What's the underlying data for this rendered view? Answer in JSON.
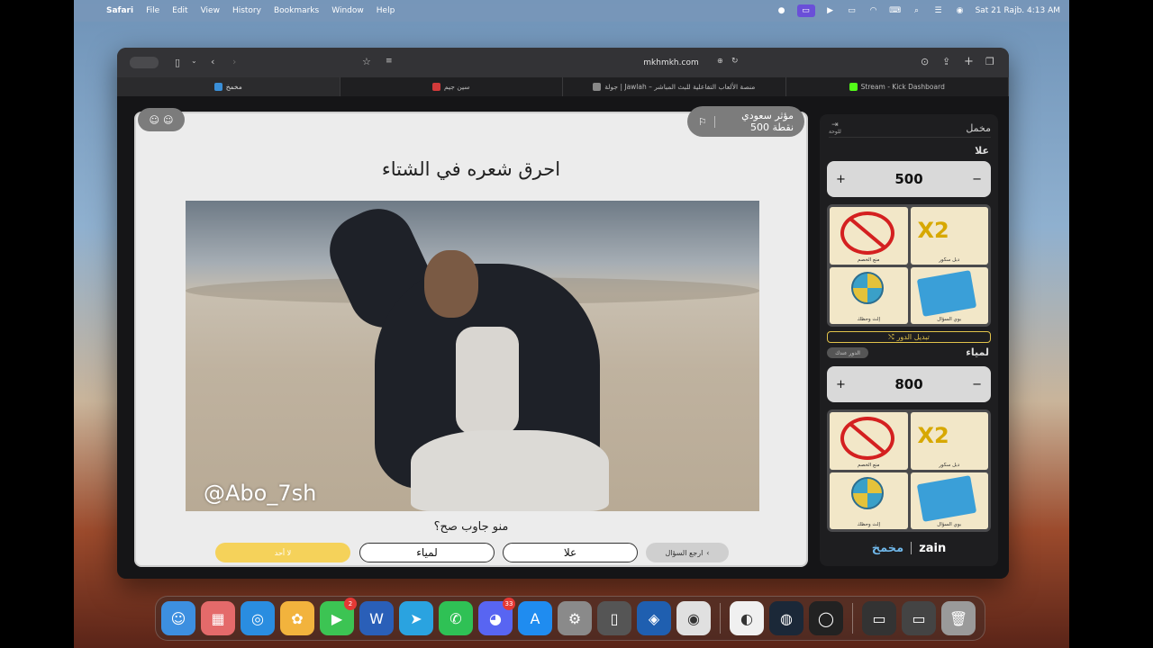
{
  "menubar": {
    "app": "Safari",
    "items": [
      "File",
      "Edit",
      "View",
      "History",
      "Bookmarks",
      "Window",
      "Help"
    ],
    "clock": "Sat 21 Rajb.  4:13 AM"
  },
  "browser": {
    "url": "mkhmkh.com",
    "tabs": [
      {
        "label": "مخمخ",
        "active": true,
        "color": "#3a8fd8"
      },
      {
        "label": "سين جيم",
        "active": false,
        "color": "#d23a3a"
      },
      {
        "label": "جولة | Jawlah – منصة الألعاب التفاعلية للبث المباشر",
        "active": false,
        "color": "#888888"
      },
      {
        "label": "Stream - Kick Dashboard",
        "active": false,
        "color": "#53fc18"
      }
    ]
  },
  "game": {
    "indicator_name": "مؤثر سعودي",
    "indicator_points": "500 نقطة",
    "question": "احرق شعره في الشتاء",
    "watermark": "@Abo_7sh",
    "who_answered": "منو جاوب صح؟",
    "answers": {
      "none": "لا أحد",
      "team2": "لمياء",
      "team1": "علا",
      "back": "ارجع السؤال"
    }
  },
  "panel": {
    "title": "مخمل",
    "exit_label": "للوحة",
    "team1": {
      "name": "علا",
      "score": "500"
    },
    "team2": {
      "name": "لمياء",
      "score": "800"
    },
    "switch_turn": "تبديل الدور",
    "turn_badge": "الدور عندك",
    "powerups": [
      "منع الخصم",
      "دبل سكور",
      "إلث وحظك",
      "بوي السؤال"
    ],
    "brand": "zain",
    "brand_logo": "مخمخ"
  },
  "dock": {
    "apps": [
      {
        "name": "finder-icon",
        "color": "#3d8fe0"
      },
      {
        "name": "launchpad-icon",
        "color": "#e46a6a"
      },
      {
        "name": "safari-icon",
        "color": "#2a8de0"
      },
      {
        "name": "photos-icon",
        "color": "#f2b33d"
      },
      {
        "name": "facetime-icon",
        "color": "#3cc453",
        "badge": "2"
      },
      {
        "name": "word-icon",
        "color": "#2a5fb8"
      },
      {
        "name": "telegram-icon",
        "color": "#2aa3e0"
      },
      {
        "name": "whatsapp-icon",
        "color": "#2fc155"
      },
      {
        "name": "discord-icon",
        "color": "#5865f2",
        "badge": "33"
      },
      {
        "name": "appstore-icon",
        "color": "#1f8cf0"
      },
      {
        "name": "settings-icon",
        "color": "#8a8a8a"
      },
      {
        "name": "iphone-mirroring-icon",
        "color": "#555555"
      },
      {
        "name": "vmware-icon",
        "color": "#1f5fb0"
      },
      {
        "name": "chrome-icon",
        "color": "#e0e0e0"
      },
      {
        "name": "obs-monitor-icon",
        "color": "#f0f0f0"
      },
      {
        "name": "steam-icon",
        "color": "#1b2838"
      },
      {
        "name": "obs-icon",
        "color": "#222222"
      },
      {
        "name": "desktop-stack-icon",
        "color": "#333333"
      },
      {
        "name": "screen-stack-icon",
        "color": "#444444"
      },
      {
        "name": "trash-icon",
        "color": "#9a9a9a"
      }
    ]
  }
}
